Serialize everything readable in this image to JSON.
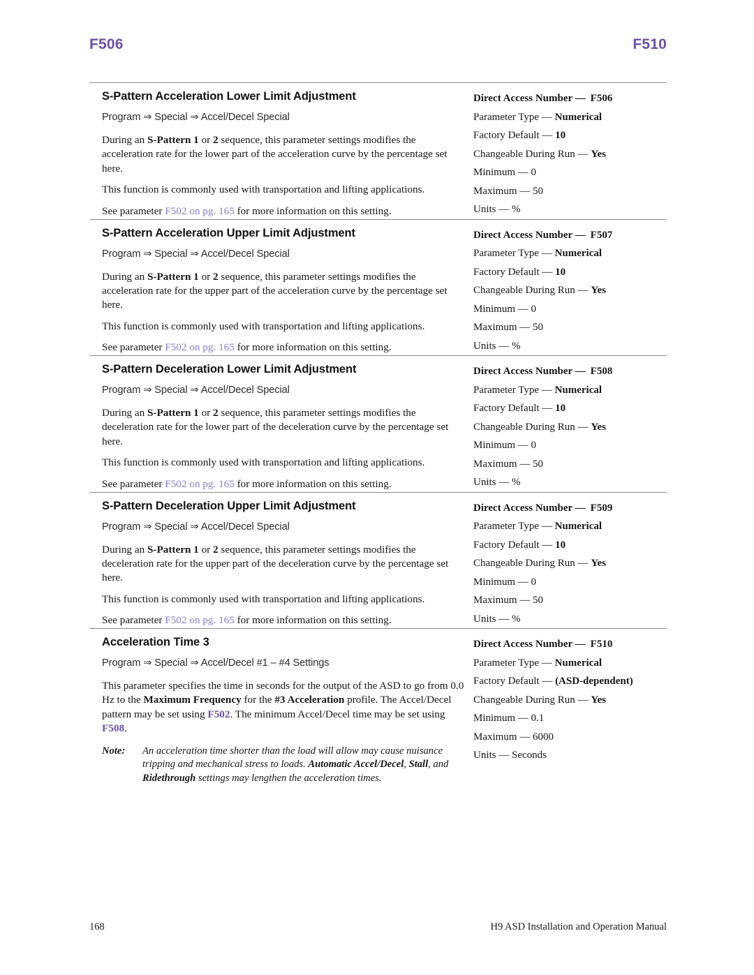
{
  "running_head": {
    "left": "F506",
    "right": "F510",
    "color": "#6b4fa6"
  },
  "footer": {
    "page_number": "168",
    "manual_title": "H9 ASD Installation and Operation Manual"
  },
  "link_color": "#8b7cc8",
  "spec_labels": {
    "direct_access": "Direct Access Number —",
    "parameter_type": "Parameter Type —",
    "factory_default": "Factory Default —",
    "changeable": "Changeable During Run —",
    "minimum": "Minimum —",
    "maximum": "Maximum —",
    "units": "Units —"
  },
  "sections": [
    {
      "title": "S-Pattern Acceleration Lower Limit Adjustment",
      "path": "Program ⇒ Special ⇒ Accel/Decel Special",
      "para1_a": "During an ",
      "para1_b": "S-Pattern 1",
      "para1_c": " or ",
      "para1_d": "2",
      "para1_e": " sequence, this parameter settings modifies the acceleration rate for the lower part of the acceleration curve by the percentage set here.",
      "para2": "This function is commonly used with transportation and lifting applications.",
      "para3_a": "See parameter ",
      "para3_link": "F502 on pg. 165",
      "para3_b": " for more information on this setting.",
      "spec": {
        "direct_access": "F506",
        "parameter_type": "Numerical",
        "factory_default": "10",
        "changeable": "Yes",
        "minimum": "0",
        "maximum": "50",
        "units": "%"
      }
    },
    {
      "title": "S-Pattern Acceleration Upper Limit Adjustment",
      "path": "Program ⇒ Special ⇒ Accel/Decel Special",
      "para1_a": "During an ",
      "para1_b": "S-Pattern 1",
      "para1_c": " or ",
      "para1_d": "2",
      "para1_e": " sequence, this parameter settings modifies the acceleration rate for the upper part of the acceleration curve by the percentage set here.",
      "para2": "This function is commonly used with transportation and lifting applications.",
      "para3_a": "See parameter ",
      "para3_link": "F502 on pg. 165",
      "para3_b": " for more information on this setting.",
      "spec": {
        "direct_access": "F507",
        "parameter_type": "Numerical",
        "factory_default": "10",
        "changeable": "Yes",
        "minimum": "0",
        "maximum": "50",
        "units": "%"
      }
    },
    {
      "title": "S-Pattern Deceleration Lower Limit Adjustment",
      "path": "Program ⇒ Special ⇒ Accel/Decel Special",
      "para1_a": "During an ",
      "para1_b": "S-Pattern 1",
      "para1_c": " or ",
      "para1_d": "2",
      "para1_e": " sequence, this parameter settings modifies the deceleration rate for the lower part of the deceleration curve by the percentage set here.",
      "para2": "This function is commonly used with transportation and lifting applications.",
      "para3_a": "See parameter ",
      "para3_link": "F502 on pg. 165",
      "para3_b": " for more information on this setting.",
      "spec": {
        "direct_access": "F508",
        "parameter_type": "Numerical",
        "factory_default": "10",
        "changeable": "Yes",
        "minimum": "0",
        "maximum": "50",
        "units": "%"
      }
    },
    {
      "title": "S-Pattern Deceleration Upper Limit Adjustment",
      "path": "Program ⇒ Special ⇒ Accel/Decel Special",
      "para1_a": "During an ",
      "para1_b": "S-Pattern 1",
      "para1_c": " or ",
      "para1_d": "2",
      "para1_e": " sequence, this parameter settings modifies the deceleration rate for the upper part of the deceleration curve by the percentage set here.",
      "para2": "This function is commonly used with transportation and lifting applications.",
      "para3_a": "See parameter ",
      "para3_link": "F502 on pg. 165",
      "para3_b": " for more information on this setting.",
      "spec": {
        "direct_access": "F509",
        "parameter_type": "Numerical",
        "factory_default": "10",
        "changeable": "Yes",
        "minimum": "0",
        "maximum": "50",
        "units": "%"
      }
    }
  ],
  "last_section": {
    "title": "Acceleration Time 3",
    "path": "Program ⇒ Special ⇒ Accel/Decel #1 – #4 Settings",
    "para_a": "This parameter specifies the time in seconds for the output of the ASD to go from 0.0 Hz to the ",
    "para_b": "Maximum Frequency",
    "para_c": " for the ",
    "para_d": "#3 Acceleration",
    "para_e": " profile. The Accel/Decel pattern may be set using ",
    "para_link1": "F502",
    "para_f": ". The minimum Accel/Decel time may be set using ",
    "para_link2": "F508",
    "para_g": ".",
    "note_label": "Note:",
    "note_a": "An acceleration time shorter than the load will allow may cause nuisance tripping and mechanical stress to loads. ",
    "note_b": "Automatic Accel/Decel",
    "note_c": ", ",
    "note_d": "Stall",
    "note_e": ", and ",
    "note_f": "Ridethrough",
    "note_g": " settings may lengthen the acceleration times.",
    "spec": {
      "direct_access": "F510",
      "parameter_type": "Numerical",
      "factory_default": "(ASD-dependent)",
      "changeable": "Yes",
      "minimum": "0.1",
      "maximum": "6000",
      "units": "Seconds"
    }
  }
}
